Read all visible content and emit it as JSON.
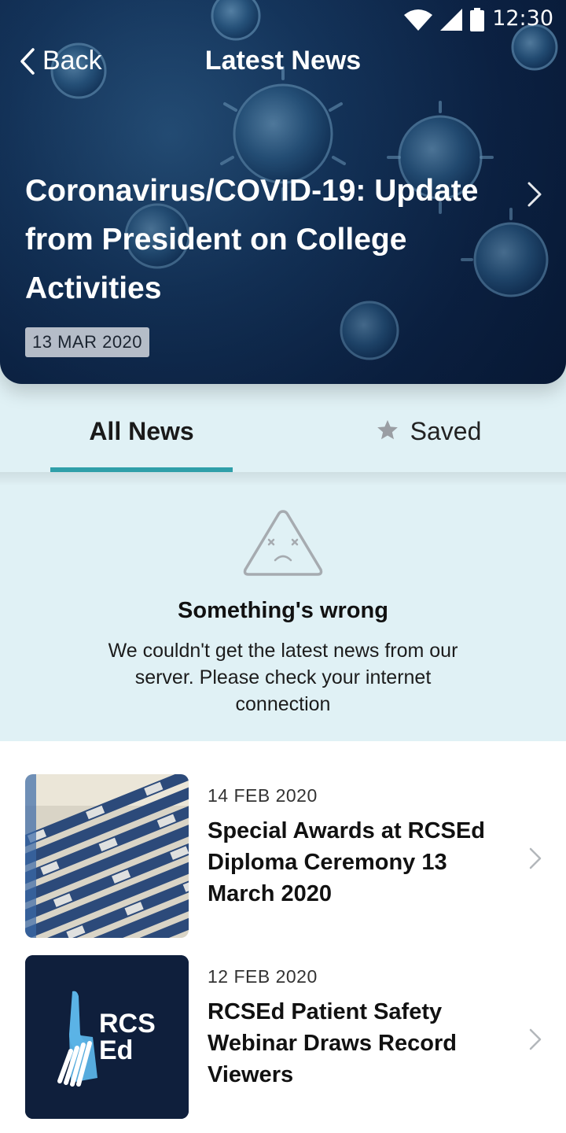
{
  "status_bar": {
    "time": "12:30"
  },
  "nav": {
    "back_label": "Back",
    "title": "Latest News"
  },
  "hero": {
    "headline": "Coronavirus/COVID-19: Update from President on College Activities",
    "date": "13 MAR 2020"
  },
  "tabs": [
    {
      "label": "All News",
      "selected": true
    },
    {
      "label": "Saved",
      "icon": "star-icon",
      "selected": false
    }
  ],
  "error": {
    "icon": "warning-triangle-sad-face-icon",
    "title": "Something's wrong",
    "message": "We couldn't get the latest news from our server. Please check your internet connection"
  },
  "news": [
    {
      "date": "14 FEB 2020",
      "title": "Special Awards at RCSEd Diploma Ceremony 13 March 2020",
      "thumb": "diploma-scrolls-photo"
    },
    {
      "date": "12 FEB 2020",
      "title": "RCSEd Patient Safety Webinar Draws Record Viewers",
      "thumb": "rcsed-logo",
      "logo_text": [
        "RCS",
        "Ed"
      ]
    }
  ],
  "colors": {
    "accent": "#2f9fa9",
    "panel_bg": "#e0f1f5",
    "logo_bg": "#0f1f3c",
    "logo_blue": "#5bb3e6"
  }
}
